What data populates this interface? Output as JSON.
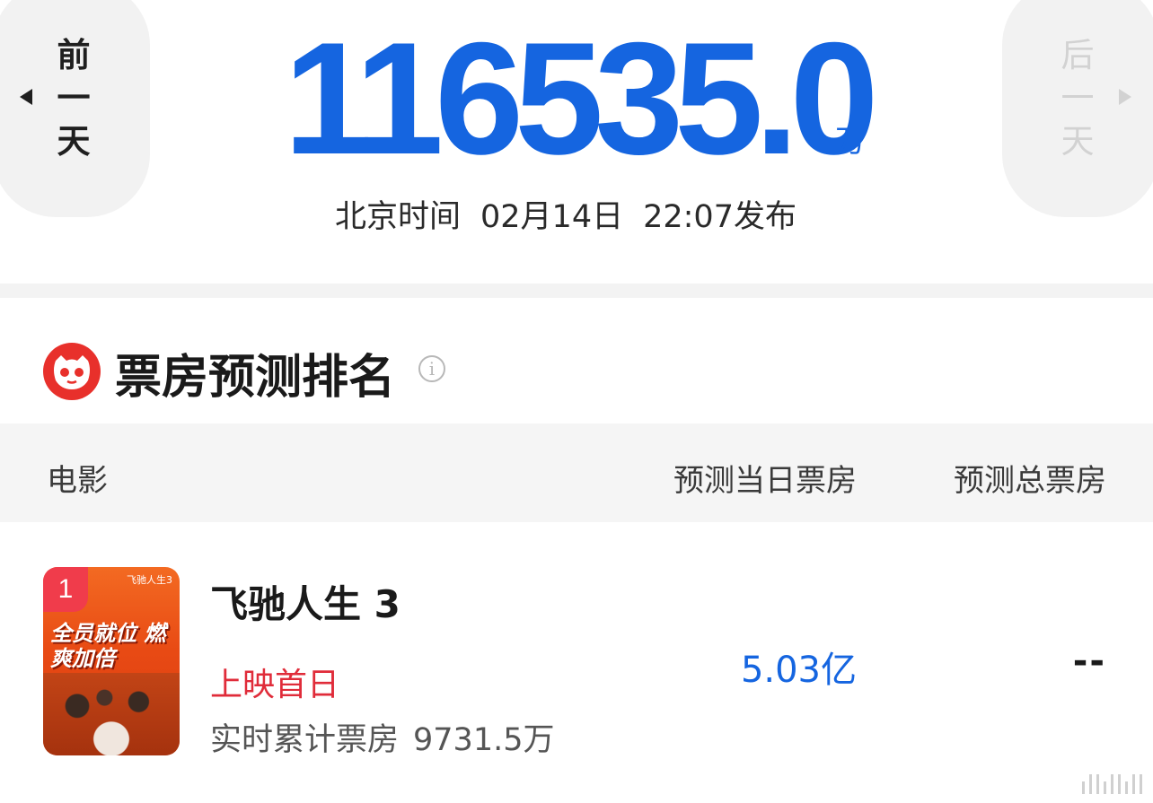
{
  "nav": {
    "prev_day": [
      "前",
      "一",
      "天"
    ],
    "next_day": [
      "后",
      "一",
      "天"
    ]
  },
  "summary": {
    "total_box_office": "116535.0",
    "unit": "万",
    "publish_prefix": "北京时间",
    "publish_date": "02月14日",
    "publish_time": "22:07发布"
  },
  "section": {
    "title": "票房预测排名",
    "info_symbol": "i"
  },
  "table": {
    "headers": {
      "movie": "电影",
      "predicted_today": "预测当日票房",
      "predicted_total": "预测总票房"
    },
    "rows": [
      {
        "rank": "1",
        "title": "飞驰人生 3",
        "status": "上映首日",
        "cumulative_label": "实时累计票房",
        "cumulative_value": "9731.5万",
        "predicted_today": "5.03亿",
        "predicted_total": "--",
        "poster_text": "全员就位 燃爽加倍",
        "poster_logo": "飞驰人生3"
      }
    ]
  },
  "colors": {
    "accent_blue": "#1565e0",
    "status_red": "#e02c3a",
    "logo_red": "#e8302b",
    "badge_red": "#f03c4b"
  },
  "icons": [
    "left-triangle-icon",
    "right-triangle-icon",
    "maoyan-cat-logo-icon",
    "info-icon"
  ]
}
